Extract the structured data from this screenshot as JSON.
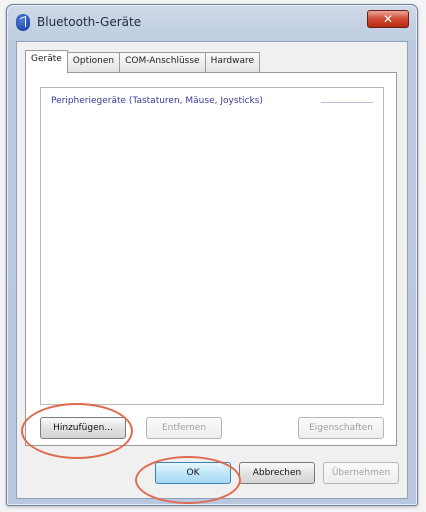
{
  "window": {
    "title": "Bluetooth-Geräte",
    "close_glyph": "✕"
  },
  "tabs": [
    {
      "label": "Geräte",
      "active": true
    },
    {
      "label": "Optionen",
      "active": false
    },
    {
      "label": "COM-Anschlüsse",
      "active": false
    },
    {
      "label": "Hardware",
      "active": false
    }
  ],
  "device_list": {
    "group_header": "Peripheriegeräte (Tastaturen, Mäuse, Joysticks)"
  },
  "buttons": {
    "add": "Hinzufügen...",
    "remove": "Entfernen",
    "properties": "Eigenschaften",
    "ok": "OK",
    "cancel": "Abbrechen",
    "apply": "Übernehmen"
  },
  "colors": {
    "highlight": "#e06a4e"
  }
}
